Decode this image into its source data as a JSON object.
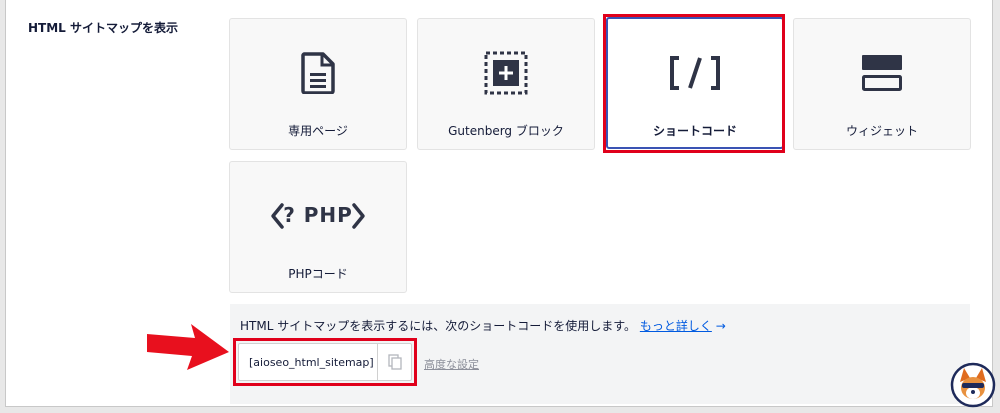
{
  "setting": {
    "label": "HTML サイトマップを表示"
  },
  "options": [
    {
      "label": "専用ページ",
      "icon": "document-icon"
    },
    {
      "label": "Gutenberg ブロック",
      "icon": "block-add-icon"
    },
    {
      "label": "ショートコード",
      "icon": "shortcode-icon",
      "glyph": "[ / ]",
      "selected": true
    },
    {
      "label": "ウィジェット",
      "icon": "widget-icon"
    },
    {
      "label": "PHPコード",
      "icon": "php-icon",
      "glyph": "<? PHP >"
    }
  ],
  "info": {
    "text": "HTML サイトマップを表示するには、次のショートコードを使用します。",
    "link": "もっと詳しく",
    "link_arrow": "→"
  },
  "shortcode": {
    "value": "[aioseo_html_sitemap]"
  },
  "advanced": {
    "label": "高度な設定"
  },
  "colors": {
    "accent": "#3a53b4",
    "highlight": "#e0001b",
    "link": "#005ae0",
    "icon": "#2f3446"
  }
}
